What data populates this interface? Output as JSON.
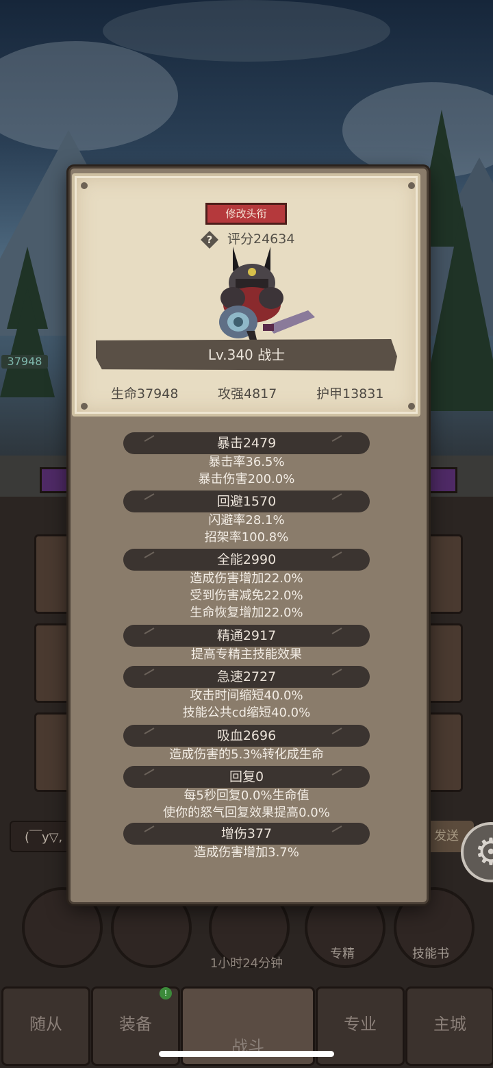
{
  "background": {
    "hp_tag": "37948",
    "chat_placeholder": "(￣y▽,",
    "send_label": "发送",
    "skill_buttons": [
      "专精",
      "技能书"
    ],
    "timer": "1小时24分钟",
    "tabs": [
      "随从",
      "装备",
      "战斗",
      "专业",
      "主城"
    ],
    "badge": "!"
  },
  "dialog": {
    "title_button": "修改头衔",
    "score": "评分24634",
    "name_level": "Lv.340 战士",
    "base_stats": [
      "生命37948",
      "攻强4817",
      "护甲13831"
    ],
    "stats": [
      {
        "header": "暴击2479",
        "lines": [
          "暴击率36.5%",
          "暴击伤害200.0%"
        ]
      },
      {
        "header": "回避1570",
        "lines": [
          "闪避率28.1%",
          "招架率100.8%"
        ]
      },
      {
        "header": "全能2990",
        "lines": [
          "造成伤害增加22.0%",
          "受到伤害减免22.0%",
          "生命恢复增加22.0%"
        ]
      },
      {
        "header": "精通2917",
        "lines": [
          "提高专精主技能效果"
        ]
      },
      {
        "header": "急速2727",
        "lines": [
          "攻击时间缩短40.0%",
          "技能公共cd缩短40.0%"
        ]
      },
      {
        "header": "吸血2696",
        "lines": [
          "造成伤害的5.3%转化成生命"
        ]
      },
      {
        "header": "回复0",
        "lines": [
          "每5秒回复0.0%生命值",
          "使你的怒气回复效果提高0.0%"
        ]
      },
      {
        "header": "增伤377",
        "lines": [
          "造成伤害增加3.7%"
        ]
      }
    ]
  },
  "colors": {
    "dialog_bg": "#8a7c6b",
    "parchment": "#e7dcc2",
    "title_button": "#b5393c",
    "stat_header": "#3b3430"
  }
}
